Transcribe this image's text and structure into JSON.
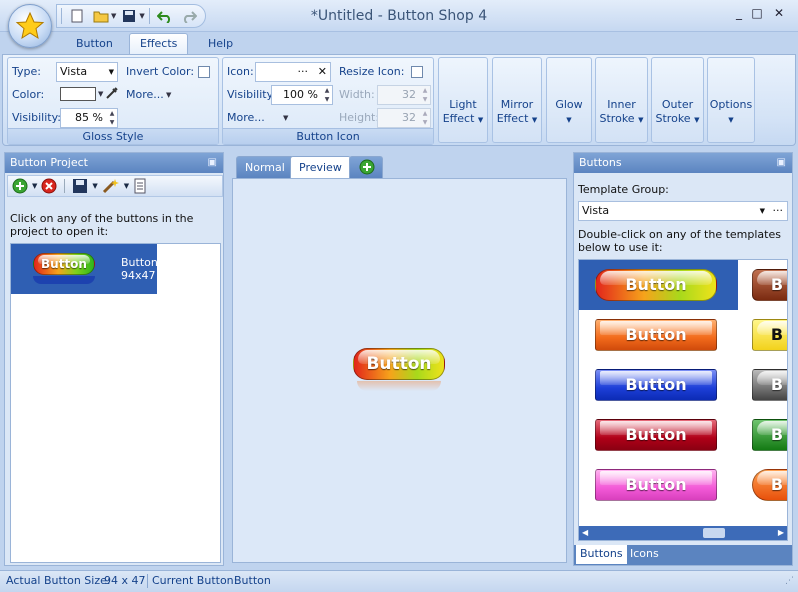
{
  "window": {
    "title": "*Untitled - Button Shop 4",
    "controls": [
      "_",
      "□",
      "✕"
    ]
  },
  "ribbon_tabs": [
    "Button",
    "Effects",
    "Help"
  ],
  "gloss_style": {
    "title": "Gloss Style",
    "type_label": "Type:",
    "type_value": "Vista",
    "invert_label": "Invert Color:",
    "color_label": "Color:",
    "more_label": "More...",
    "visibility_label": "Visibility:",
    "visibility_value": "85 %"
  },
  "button_icon": {
    "title": "Button Icon",
    "icon_label": "Icon:",
    "icon_more": "···",
    "resize_label": "Resize Icon:",
    "visibility_label": "Visibility:",
    "visibility_value": "100 %",
    "width_label": "Width:",
    "width_value": "32",
    "more_label": "More...",
    "height_label": "Height:",
    "height_value": "32"
  },
  "effect_buttons": [
    {
      "line1": "Light",
      "line2": "Effect"
    },
    {
      "line1": "Mirror",
      "line2": "Effect"
    },
    {
      "line1": "Glow",
      "line2": ""
    },
    {
      "line1": "Inner",
      "line2": "Stroke"
    },
    {
      "line1": "Outer",
      "line2": "Stroke"
    },
    {
      "line1": "Options",
      "line2": ""
    }
  ],
  "project_panel": {
    "title": "Button Project",
    "hint": "Click on any of the buttons in the project to open it:",
    "item": {
      "thumb_text": "Button",
      "name": "Button",
      "size": "94x47"
    }
  },
  "center": {
    "tabs": [
      "Normal",
      "Preview"
    ],
    "preview_text": "Button"
  },
  "buttons_panel": {
    "title": "Buttons",
    "group_label": "Template Group:",
    "group_value": "Vista",
    "hint": "Double-click on any of the templates below to use it:",
    "templates": [
      "Button",
      "Button",
      "Button",
      "Button",
      "Button"
    ],
    "partial": [
      "B",
      "B",
      "B",
      "B",
      "B"
    ],
    "bottom_tabs": [
      "Buttons",
      "Icons"
    ]
  },
  "colors": {
    "accent": "#2f5fb3",
    "orange": "#f26a1b",
    "blue": "#1d3fd8",
    "red": "#b00018",
    "pink": "#f35ad7"
  },
  "status": {
    "size_label": "Actual Button Size:",
    "size_value": "94 x 47",
    "current_label": "Current Button:",
    "current_value": "Button"
  }
}
